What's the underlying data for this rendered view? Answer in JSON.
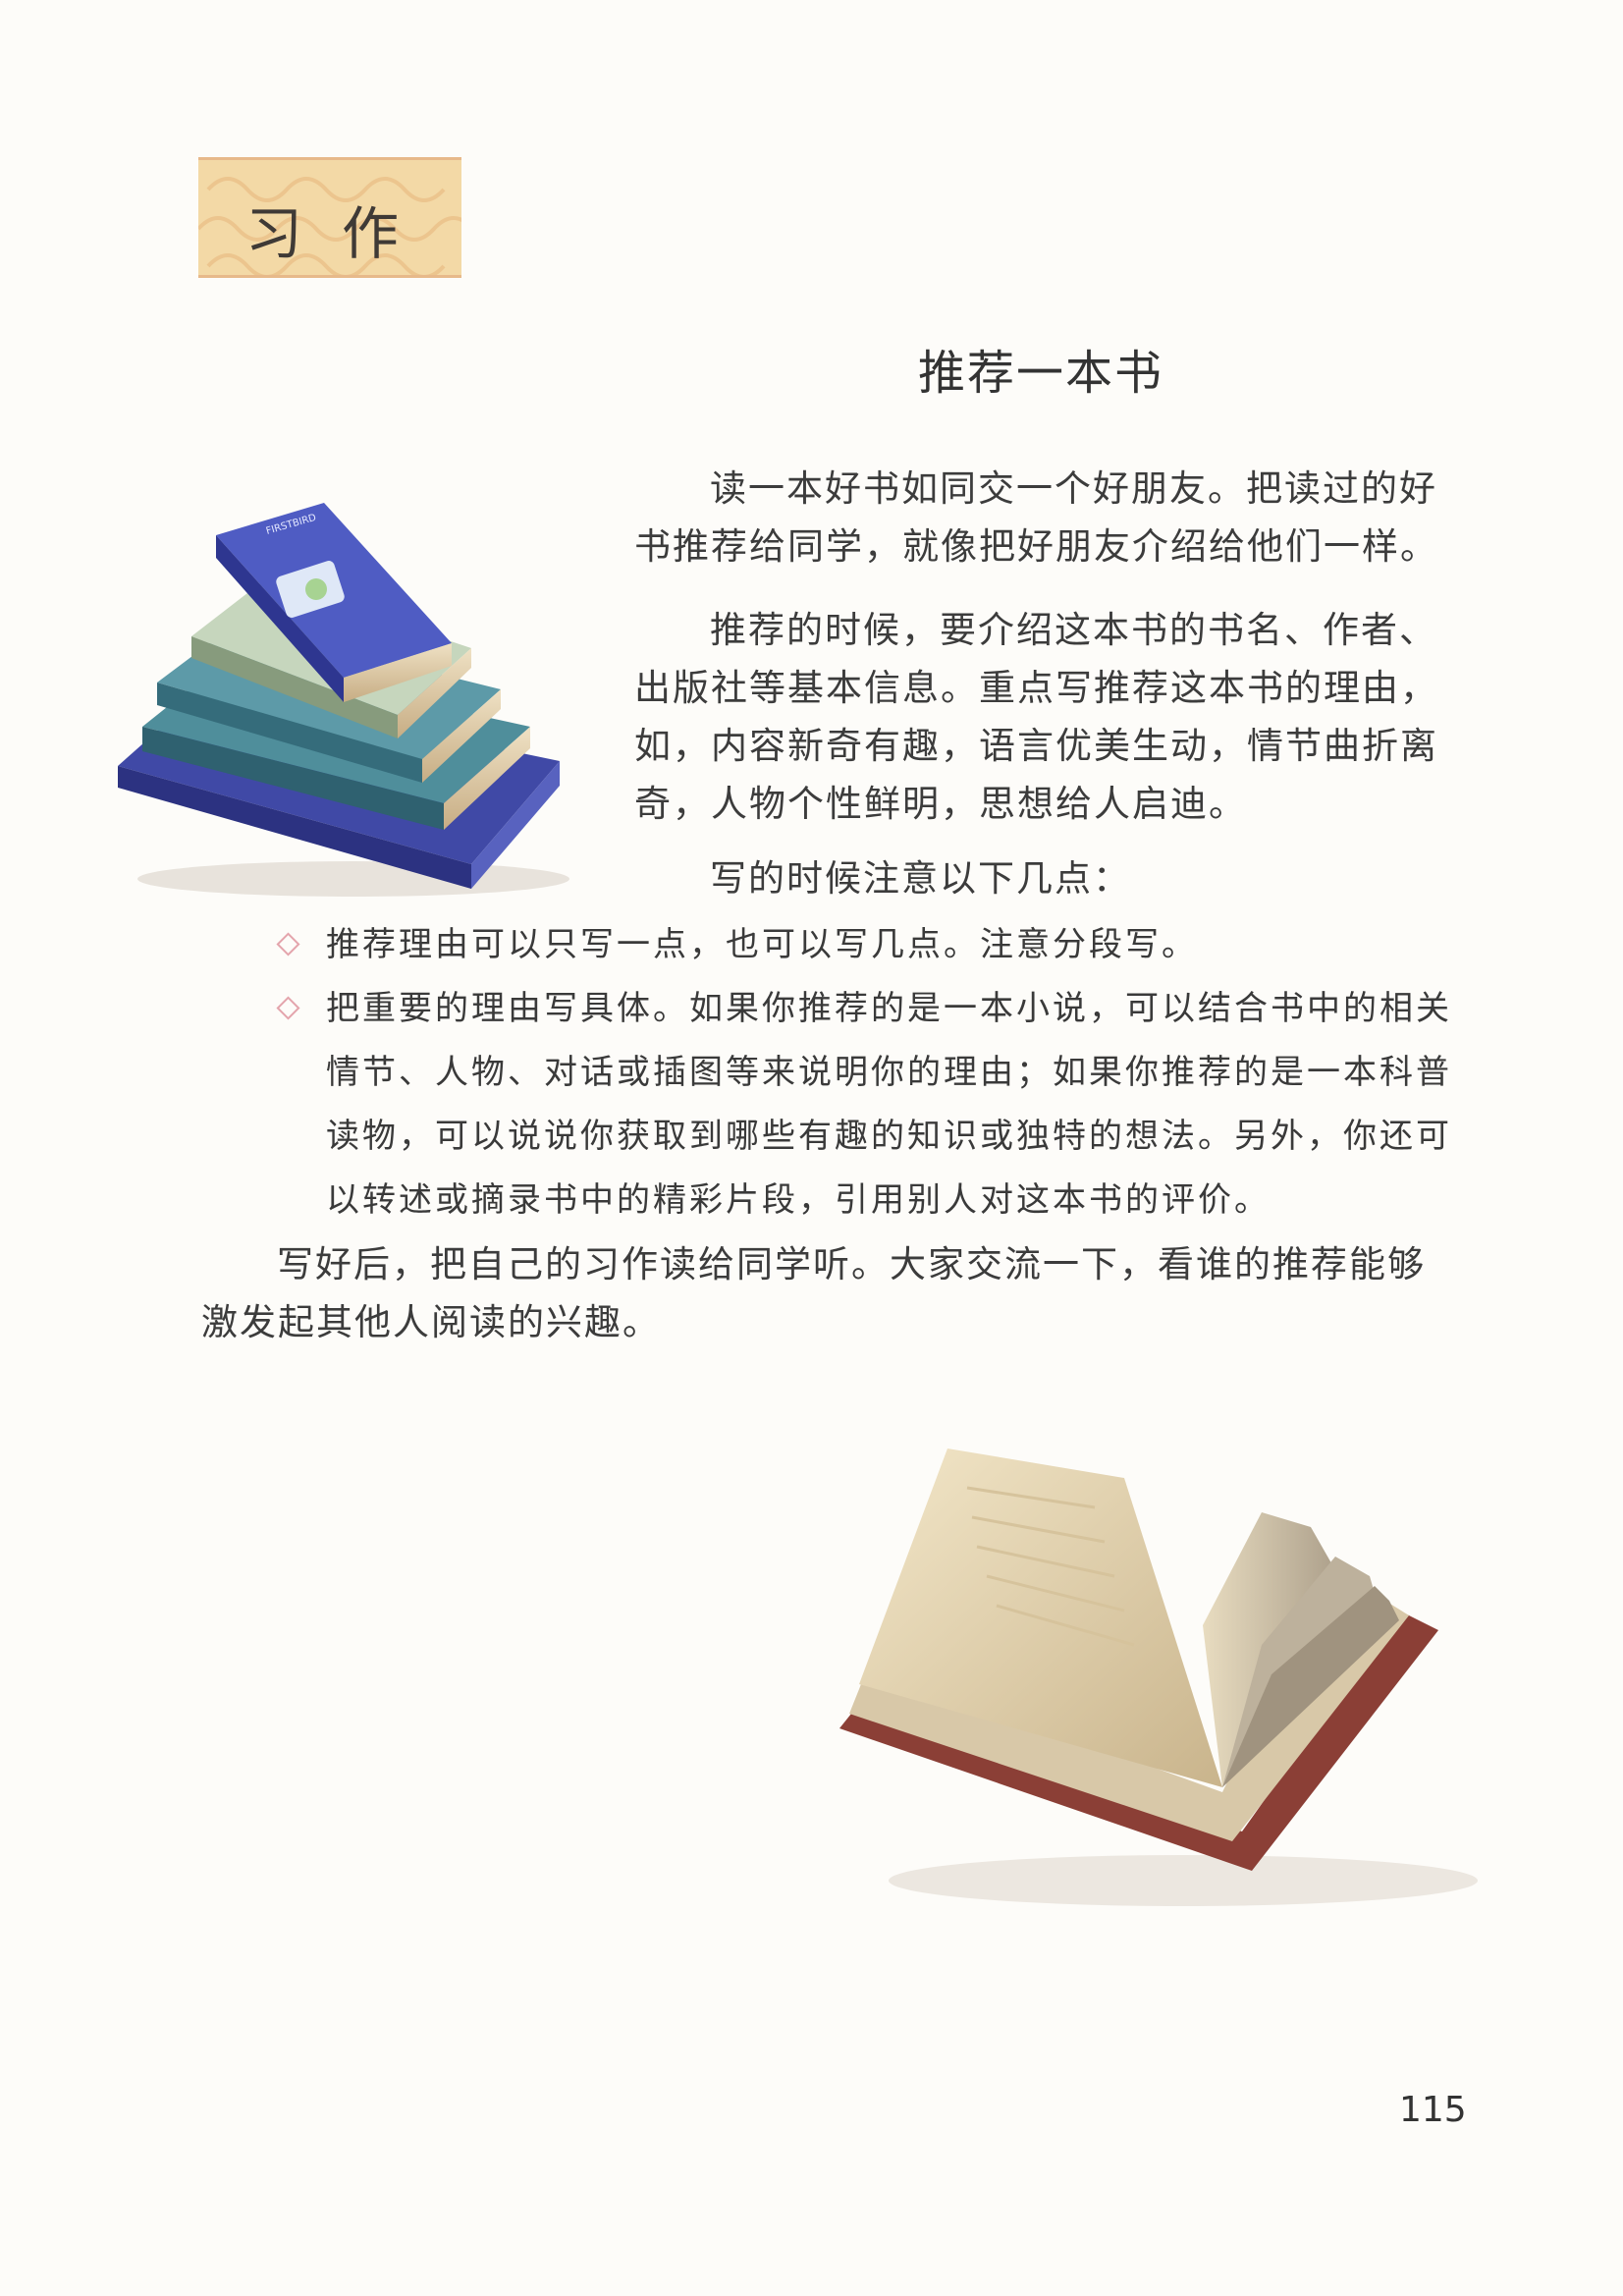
{
  "section_tag": "习作",
  "title": "推荐一本书",
  "paragraphs": {
    "intro": "读一本好书如同交一个好朋友。把读过的好书推荐给同学，就像把好朋友介绍给他们一样。",
    "how": "推荐的时候，要介绍这本书的书名、作者、出版社等基本信息。重点写推荐这本书的理由，如，内容新奇有趣，语言优美生动，情节曲折离奇，人物个性鲜明，思想给人启迪。",
    "notes_lead": "写的时候注意以下几点：",
    "closing": "写好后，把自己的习作读给同学听。大家交流一下，看谁的推荐能够激发起其他人阅读的兴趣。"
  },
  "bullets": [
    "推荐理由可以只写一点，也可以写几点。注意分段写。",
    "把重要的理由写具体。如果你推荐的是一本小说，可以结合书中的相关情节、人物、对话或插图等来说明你的理由；如果你推荐的是一本科普读物，可以说说你获取到哪些有趣的知识或独特的想法。另外，你还可以转述或摘录书中的精彩片段，引用别人对这本书的评价。"
  ],
  "page_number": "115",
  "colors": {
    "tag_background": "#f3d9a6",
    "tag_border": "#e7b98a",
    "bullet_diamond": "#e4a4ac",
    "book_blue": "#4a58b8"
  }
}
